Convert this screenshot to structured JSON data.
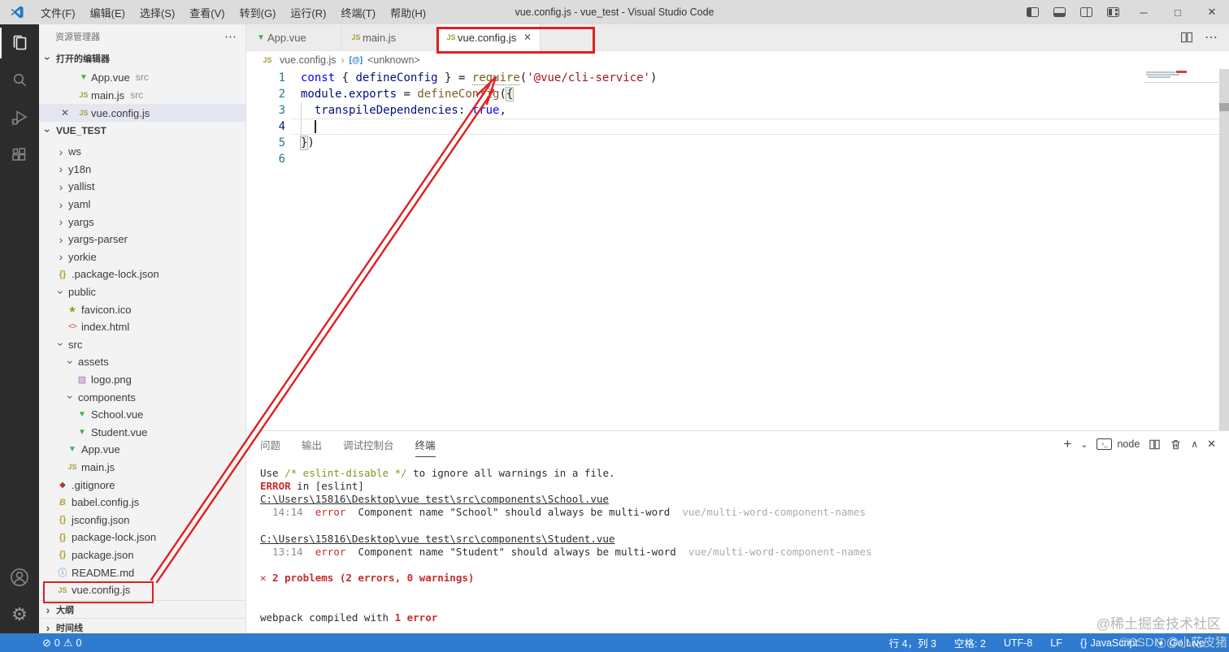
{
  "title_bar": {
    "menus": [
      "文件(F)",
      "编辑(E)",
      "选择(S)",
      "查看(V)",
      "转到(G)",
      "运行(R)",
      "终端(T)",
      "帮助(H)"
    ],
    "title": "vue.config.js - vue_test - Visual Studio Code",
    "window_controls": {
      "minimize": "─",
      "maximize": "□",
      "close": "✕"
    }
  },
  "activity_bar": {
    "items": [
      "explorer",
      "search",
      "run-and-debug",
      "extensions"
    ],
    "bottom_items": [
      "account",
      "settings"
    ]
  },
  "sidebar": {
    "header": "资源管理器",
    "open_editors_label": "打开的编辑器",
    "open_editors": [
      {
        "icon": "vue",
        "label": "App.vue",
        "desc": "src",
        "selected": false,
        "close": false
      },
      {
        "icon": "js",
        "label": "main.js",
        "desc": "src",
        "selected": false,
        "close": false
      },
      {
        "icon": "js",
        "label": "vue.config.js",
        "desc": "",
        "selected": true,
        "close": true
      }
    ],
    "workspace": "VUE_TEST",
    "tree": [
      {
        "label": "ws",
        "folder": true,
        "open": false,
        "lvl": 1
      },
      {
        "label": "y18n",
        "folder": true,
        "open": false,
        "lvl": 1
      },
      {
        "label": "yallist",
        "folder": true,
        "open": false,
        "lvl": 1
      },
      {
        "label": "yaml",
        "folder": true,
        "open": false,
        "lvl": 1
      },
      {
        "label": "yargs",
        "folder": true,
        "open": false,
        "lvl": 1
      },
      {
        "label": "yargs-parser",
        "folder": true,
        "open": false,
        "lvl": 1
      },
      {
        "label": "yorkie",
        "folder": true,
        "open": false,
        "lvl": 1
      },
      {
        "label": ".package-lock.json",
        "icon": "json",
        "lvl": 1
      },
      {
        "label": "public",
        "folder": true,
        "open": true,
        "lvl": 1
      },
      {
        "label": "favicon.ico",
        "icon": "star",
        "lvl": 2
      },
      {
        "label": "index.html",
        "icon": "html",
        "lvl": 2
      },
      {
        "label": "src",
        "folder": true,
        "open": true,
        "lvl": 1
      },
      {
        "label": "assets",
        "folder": true,
        "open": true,
        "lvl": 2
      },
      {
        "label": "logo.png",
        "icon": "img",
        "lvl": 3
      },
      {
        "label": "components",
        "folder": true,
        "open": true,
        "lvl": 2
      },
      {
        "label": "School.vue",
        "icon": "vue",
        "lvl": 3
      },
      {
        "label": "Student.vue",
        "icon": "vue",
        "lvl": 3
      },
      {
        "label": "App.vue",
        "icon": "vue",
        "lvl": 2
      },
      {
        "label": "main.js",
        "icon": "js",
        "lvl": 2
      },
      {
        "label": ".gitignore",
        "icon": "git",
        "lvl": 1
      },
      {
        "label": "babel.config.js",
        "icon": "babel",
        "lvl": 1
      },
      {
        "label": "jsconfig.json",
        "icon": "json",
        "lvl": 1
      },
      {
        "label": "package-lock.json",
        "icon": "json",
        "lvl": 1
      },
      {
        "label": "package.json",
        "icon": "json",
        "lvl": 1
      },
      {
        "label": "README.md",
        "icon": "info",
        "lvl": 1
      },
      {
        "label": "vue.config.js",
        "icon": "js",
        "lvl": 1,
        "boxed": true
      }
    ],
    "bottom_sections": [
      "大纲",
      "时间线"
    ]
  },
  "tabs": [
    {
      "icon": "vue",
      "label": "App.vue",
      "active": false
    },
    {
      "icon": "js",
      "label": "main.js",
      "active": false
    },
    {
      "icon": "js",
      "label": "vue.config.js",
      "active": true,
      "close": "✕"
    }
  ],
  "breadcrumb": {
    "file": "vue.config.js",
    "symbol": "<unknown>"
  },
  "editor": {
    "code_lines": [
      {
        "num": "1",
        "tokens": [
          {
            "t": "const",
            "c": "kw"
          },
          {
            "t": " { ",
            "c": "pp"
          },
          {
            "t": "defineConfig",
            "c": "vr"
          },
          {
            "t": " } = ",
            "c": "pp"
          },
          {
            "t": "require",
            "c": "fn rq"
          },
          {
            "t": "(",
            "c": "pp"
          },
          {
            "t": "'@vue/cli-service'",
            "c": "st"
          },
          {
            "t": ")",
            "c": "pp"
          }
        ]
      },
      {
        "num": "2",
        "tokens": [
          {
            "t": "module",
            "c": "vr"
          },
          {
            "t": ".",
            "c": "pp"
          },
          {
            "t": "exports",
            "c": "vr"
          },
          {
            "t": " = ",
            "c": "pp"
          },
          {
            "t": "defineConfig",
            "c": "fn"
          },
          {
            "t": "(",
            "c": "pp"
          },
          {
            "t": "{",
            "c": "pp bm"
          }
        ]
      },
      {
        "num": "3",
        "tokens": [
          {
            "t": "  ",
            "c": "pp"
          },
          {
            "t": "transpileDependencies",
            "c": "vr"
          },
          {
            "t": ": ",
            "c": "pp"
          },
          {
            "t": "true",
            "c": "kw"
          },
          {
            "t": ",",
            "c": "pp"
          }
        ]
      },
      {
        "num": "4",
        "tokens": [],
        "current": true
      },
      {
        "num": "5",
        "tokens": [
          {
            "t": "}",
            "c": "pp bm"
          },
          {
            "t": ")",
            "c": "pp"
          }
        ]
      },
      {
        "num": "6",
        "tokens": []
      }
    ]
  },
  "panel": {
    "tabs": [
      "问题",
      "输出",
      "调试控制台",
      "终端"
    ],
    "active_tab": "终端",
    "terminal_name": "node",
    "terminal_lines": [
      [
        {
          "t": "Use ",
          "c": "tx"
        },
        {
          "t": "/* eslint-disable */",
          "c": "ol"
        },
        {
          "t": " to ignore all warnings in a file.",
          "c": "tx"
        }
      ],
      [
        {
          "t": "ERROR",
          "c": "er"
        },
        {
          "t": " in [eslint]",
          "c": "tx"
        }
      ],
      [
        {
          "t": "C:\\Users\\15816\\Desktop\\vue test\\src\\components\\School.vue",
          "c": "lk"
        }
      ],
      [
        {
          "t": "  14:14",
          "c": "gy"
        },
        {
          "t": "  ",
          "c": "tx"
        },
        {
          "t": "error",
          "c": "rd"
        },
        {
          "t": "  Component name \"School\" should always be multi-word  ",
          "c": "tx"
        },
        {
          "t": "vue/multi-word-component-names",
          "c": "dm"
        }
      ],
      [],
      [
        {
          "t": "C:\\Users\\15816\\Desktop\\vue test\\src\\components\\Student.vue",
          "c": "lk"
        }
      ],
      [
        {
          "t": "  13:14",
          "c": "gy"
        },
        {
          "t": "  ",
          "c": "tx"
        },
        {
          "t": "error",
          "c": "rd"
        },
        {
          "t": "  Component name \"Student\" should always be multi-word  ",
          "c": "tx"
        },
        {
          "t": "vue/multi-word-component-names",
          "c": "dm"
        }
      ],
      [],
      [
        {
          "t": "✕ 2 problems (2 errors, 0 warnings)",
          "c": "er"
        }
      ],
      [],
      [],
      [
        {
          "t": "webpack compiled with ",
          "c": "tx"
        },
        {
          "t": "1 error",
          "c": "er"
        }
      ]
    ]
  },
  "status_bar": {
    "errors": "0",
    "warnings": "0",
    "right_items": [
      {
        "label": "行 4，列 3"
      },
      {
        "label": "空格: 2"
      },
      {
        "label": "UTF-8"
      },
      {
        "label": "LF"
      },
      {
        "icon": "{}",
        "label": "JavaScript"
      },
      {
        "icon": "⦿",
        "label": "Go Live"
      }
    ]
  },
  "watermarks": {
    "juejin": "@稀土掘金技术社区",
    "csdn": "©CSDN @小花皮猪"
  }
}
